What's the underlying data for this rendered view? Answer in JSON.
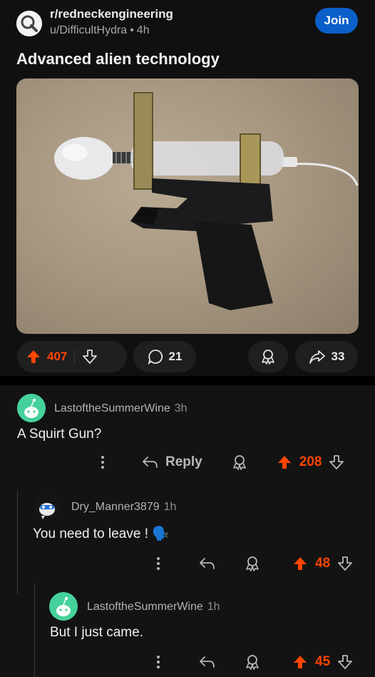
{
  "post": {
    "subreddit": "r/redneckengineering",
    "author": "u/DifficultHydra",
    "separator": "•",
    "time": "4h",
    "join_label": "Join",
    "title": "Advanced alien technology",
    "score": "407",
    "comments_count": "21",
    "shares_count": "33"
  },
  "comments": [
    {
      "author": "LastoftheSummerWine",
      "time": "3h",
      "body": "A Squirt Gun?",
      "reply_label": "Reply",
      "score": "208"
    },
    {
      "author": "Dry_Manner3879",
      "time": "1h",
      "body": "You need to leave ! 🗣️",
      "score": "48"
    },
    {
      "author": "LastoftheSummerWine",
      "time": "1h",
      "body": "But I just came.",
      "score": "45"
    }
  ],
  "colors": {
    "accent": "#ff4500",
    "join": "#0a5fc9",
    "avatar_green": "#46d19b"
  }
}
